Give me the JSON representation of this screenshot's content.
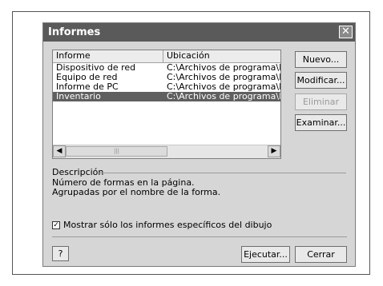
{
  "dialog": {
    "title": "Informes",
    "close_glyph": "✕"
  },
  "list": {
    "headers": [
      "Informe",
      "Ubicación"
    ],
    "rows": [
      {
        "name": "Dispositivo de red",
        "location": "C:\\Archivos de programa\\Micros",
        "selected": false
      },
      {
        "name": "Equipo de red",
        "location": "C:\\Archivos de programa\\Micros",
        "selected": false
      },
      {
        "name": "Informe de PC",
        "location": "C:\\Archivos de programa\\Micros",
        "selected": false
      },
      {
        "name": "Inventario",
        "location": "C:\\Archivos de programa\\Micros",
        "selected": true
      }
    ],
    "scroll_left_glyph": "◀",
    "scroll_right_glyph": "▶",
    "scroll_thumb_grip": "|||"
  },
  "buttons": {
    "nuevo": "Nuevo...",
    "modificar": "Modificar...",
    "eliminar": "Eliminar",
    "examinar": "Examinar...",
    "ejecutar": "Ejecutar...",
    "cerrar": "Cerrar"
  },
  "description": {
    "label": "Descripción",
    "line1": "Número de formas en la página.",
    "line2": "Agrupadas por el nombre de la forma."
  },
  "option": {
    "label": "Mostrar sólo los informes específicos del dibujo",
    "checked": true,
    "check_glyph": "✓"
  },
  "help": {
    "icon_glyph": "?"
  },
  "icons": [
    "close-icon",
    "scroll-left-icon",
    "scroll-right-icon",
    "checkmark-icon",
    "help-icon"
  ]
}
